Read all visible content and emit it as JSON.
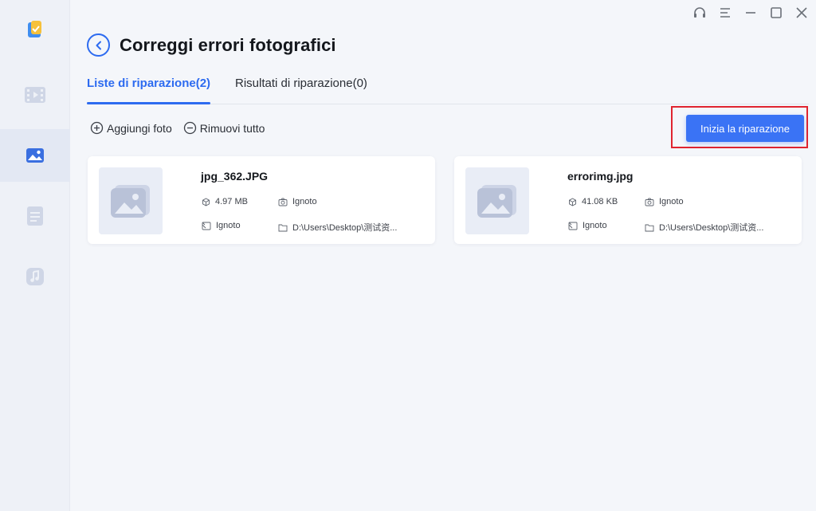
{
  "window": {
    "controls": [
      {
        "name": "support-icon"
      },
      {
        "name": "menu-icon"
      },
      {
        "name": "minimize-icon"
      },
      {
        "name": "maximize-icon"
      },
      {
        "name": "close-icon"
      }
    ]
  },
  "sidebar": {
    "items": [
      {
        "name": "home",
        "icon": "app-logo-icon",
        "active": false
      },
      {
        "name": "video",
        "icon": "video-icon",
        "active": false
      },
      {
        "name": "photo",
        "icon": "photo-icon",
        "active": true
      },
      {
        "name": "document",
        "icon": "document-icon",
        "active": false
      },
      {
        "name": "audio",
        "icon": "music-icon",
        "active": false
      }
    ]
  },
  "header": {
    "title": "Correggi errori fotografici"
  },
  "tabs": [
    {
      "label": "Liste di riparazione(2)",
      "active": true
    },
    {
      "label": "Risultati di riparazione(0)",
      "active": false
    }
  ],
  "toolbar": {
    "add_label": "Aggiungi foto",
    "remove_label": "Rimuovi tutto",
    "start_label": "Inizia la riparazione"
  },
  "files": [
    {
      "name": "jpg_362.JPG",
      "size": "4.97 MB",
      "camera": "Ignoto",
      "resolution": "Ignoto",
      "path": "D:\\Users\\Desktop\\测试资..."
    },
    {
      "name": "errorimg.jpg",
      "size": "41.08 KB",
      "camera": "Ignoto",
      "resolution": "Ignoto",
      "path": "D:\\Users\\Desktop\\测试资..."
    }
  ],
  "colors": {
    "accent": "#2d6bf0",
    "primary_button": "#3a73f5",
    "highlight": "#e0242f"
  }
}
